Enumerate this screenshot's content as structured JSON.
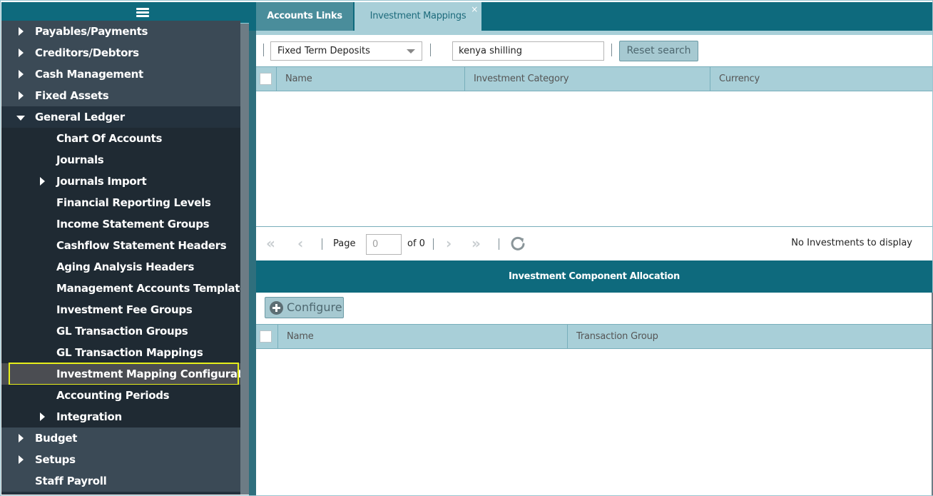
{
  "sidebar": {
    "menu_icon": "hamburger-menu-icon",
    "items": [
      {
        "label": "Payables/Payments",
        "expander": "collapsed"
      },
      {
        "label": "Creditors/Debtors",
        "expander": "collapsed"
      },
      {
        "label": "Cash Management",
        "expander": "collapsed"
      },
      {
        "label": "Fixed Assets",
        "expander": "collapsed"
      },
      {
        "label": "General Ledger",
        "expander": "expanded"
      },
      {
        "label": "Chart Of Accounts"
      },
      {
        "label": "Journals"
      },
      {
        "label": "Journals Import",
        "expander": "collapsed"
      },
      {
        "label": "Financial Reporting Levels"
      },
      {
        "label": "Income Statement Groups"
      },
      {
        "label": "Cashflow Statement Headers"
      },
      {
        "label": "Aging Analysis Headers"
      },
      {
        "label": "Management Accounts Templates"
      },
      {
        "label": "Investment Fee Groups"
      },
      {
        "label": "GL Transaction Groups"
      },
      {
        "label": "GL Transaction Mappings"
      },
      {
        "label": "Investment Mapping Configuration",
        "selected": true
      },
      {
        "label": "Accounting Periods"
      },
      {
        "label": "Integration",
        "expander": "collapsed"
      },
      {
        "label": "Budget",
        "expander": "collapsed"
      },
      {
        "label": "Setups",
        "expander": "collapsed"
      },
      {
        "label": "Staff Payroll"
      }
    ]
  },
  "tabs": [
    {
      "label": "Accounts Links",
      "active": false
    },
    {
      "label": "Investment Mappings",
      "active": true,
      "close": "×"
    }
  ],
  "toolbar": {
    "category_value": "Fixed Term Deposits",
    "search_value": "kenya shilling",
    "reset_label": "Reset search"
  },
  "investments_grid": {
    "columns": [
      "Name",
      "Investment Category",
      "Currency"
    ],
    "rows": []
  },
  "pager": {
    "page_label": "Page",
    "page_value": "0",
    "of_label": "of 0",
    "status": "No Investments to display"
  },
  "allocation": {
    "title": "Investment Component Allocation",
    "configure_label": "Configure",
    "columns": [
      "Name",
      "Transaction Group"
    ],
    "rows": []
  },
  "colors": {
    "header_teal": "#0e6a7d",
    "grid_header": "#a8cfd8",
    "sidebar_dark": "#24323e",
    "selection_outline": "#e6ee1a"
  }
}
